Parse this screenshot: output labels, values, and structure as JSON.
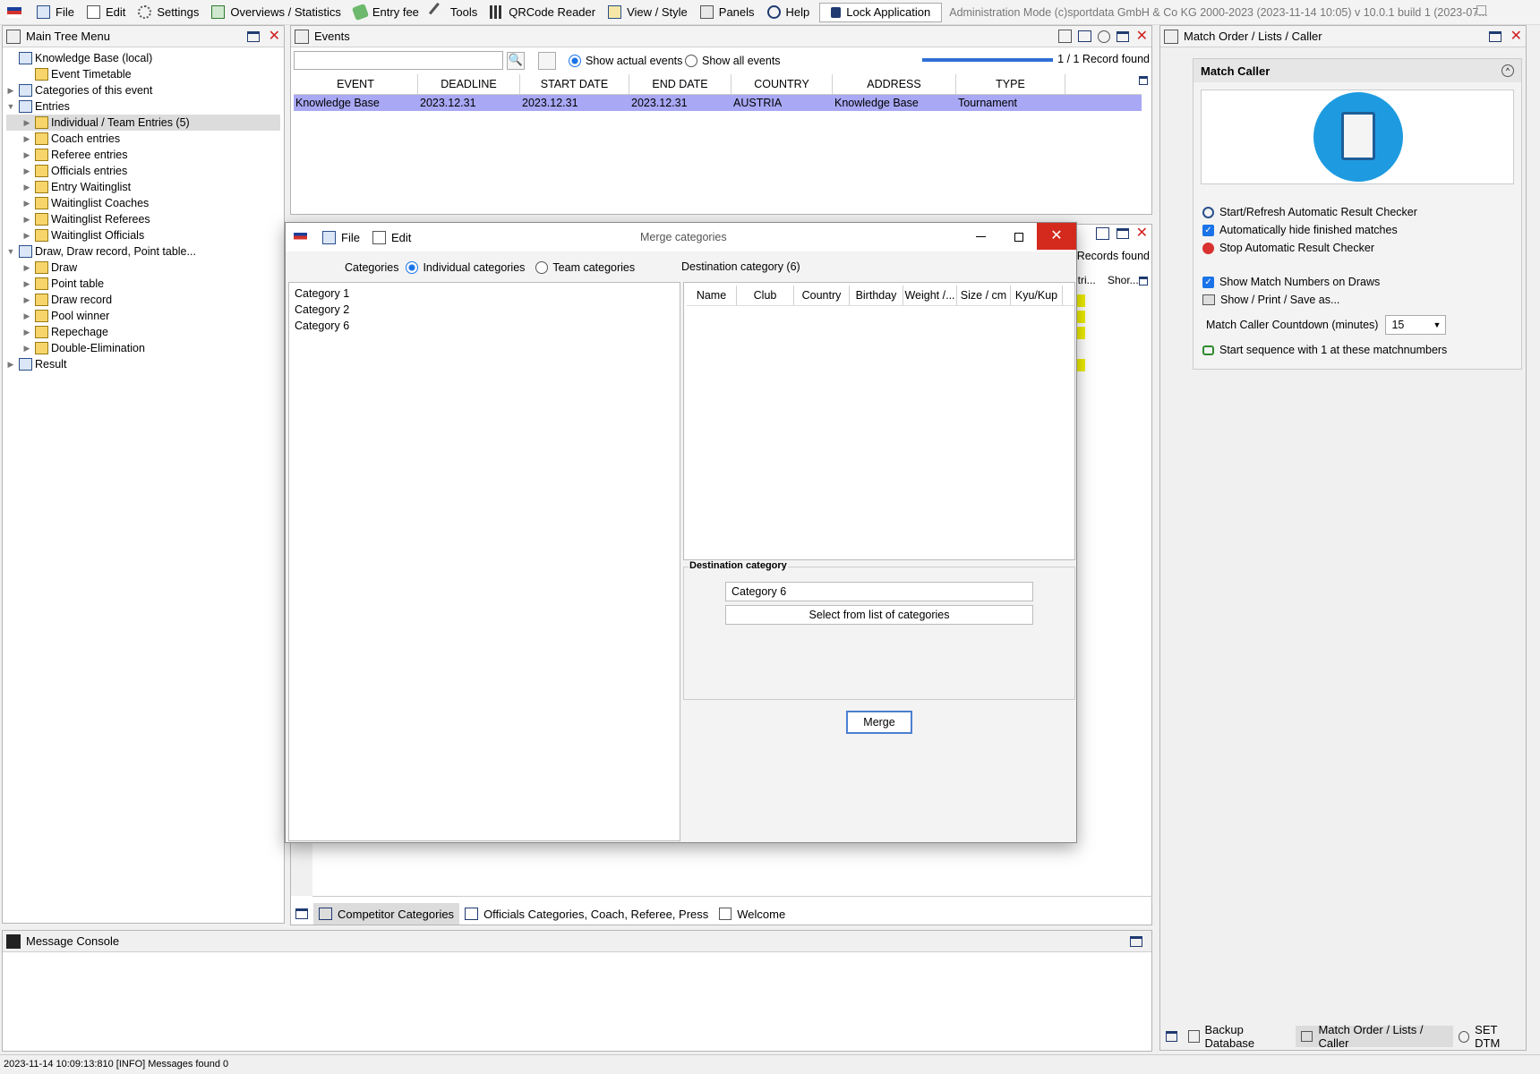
{
  "menu": {
    "items": [
      "File",
      "Edit",
      "Settings",
      "Overviews / Statistics",
      "Entry fee",
      "Tools",
      "QRCode Reader",
      "View / Style",
      "Panels",
      "Help"
    ],
    "lock": "Lock Application",
    "admin": "Administration Mode (c)sportdata GmbH & Co KG 2000-2023 (2023-11-14 10:05)  v 10.0.1 build 1 (2023-07..."
  },
  "tree": {
    "title": "Main Tree Menu",
    "items": [
      {
        "label": "Knowledge Base (local)",
        "level": 0,
        "tri": ""
      },
      {
        "label": "Event Timetable",
        "level": 1,
        "tri": ""
      },
      {
        "label": "Categories of this event",
        "level": 0,
        "tri": "▶"
      },
      {
        "label": "Entries",
        "level": 0,
        "tri": "▼"
      },
      {
        "label": "Individual / Team Entries (5)",
        "level": 1,
        "tri": "▶"
      },
      {
        "label": "Coach entries",
        "level": 1,
        "tri": "▶"
      },
      {
        "label": "Referee entries",
        "level": 1,
        "tri": "▶"
      },
      {
        "label": "Officials entries",
        "level": 1,
        "tri": "▶"
      },
      {
        "label": "Entry Waitinglist",
        "level": 1,
        "tri": "▶"
      },
      {
        "label": "Waitinglist Coaches",
        "level": 1,
        "tri": "▶"
      },
      {
        "label": "Waitinglist Referees",
        "level": 1,
        "tri": "▶"
      },
      {
        "label": "Waitinglist Officials",
        "level": 1,
        "tri": "▶"
      },
      {
        "label": "Draw, Draw record, Point table...",
        "level": 0,
        "tri": "▼"
      },
      {
        "label": "Draw",
        "level": 1,
        "tri": "▶"
      },
      {
        "label": "Point table",
        "level": 1,
        "tri": "▶"
      },
      {
        "label": "Draw record",
        "level": 1,
        "tri": "▶"
      },
      {
        "label": "Pool winner",
        "level": 1,
        "tri": "▶"
      },
      {
        "label": "Repechage",
        "level": 1,
        "tri": "▶"
      },
      {
        "label": "Double-Elimination",
        "level": 1,
        "tri": "▶"
      },
      {
        "label": "Result",
        "level": 0,
        "tri": "▶"
      }
    ]
  },
  "events": {
    "title": "Events",
    "show_actual": "Show actual events",
    "show_all": "Show all events",
    "records": "1 / 1 Record found",
    "columns": [
      "EVENT",
      "DEADLINE",
      "START DATE",
      "END DATE",
      "COUNTRY",
      "ADDRESS",
      "TYPE"
    ],
    "row": [
      "Knowledge Base",
      "2023.12.31",
      "2023.12.31",
      "2023.12.31",
      "AUSTRIA",
      "Knowledge Base",
      "Tournament"
    ]
  },
  "bgpanel": {
    "records": "5 Records found",
    "col1": "ntri...",
    "col2": "Shor..."
  },
  "dialog": {
    "title": "Merge categories",
    "file": "File",
    "edit": "Edit",
    "categories_label": "Categories",
    "individual": "Individual categories",
    "team": "Team categories",
    "destination_header": "Destination category (6)",
    "list": [
      "Category 1",
      "Category 2",
      "Category 6"
    ],
    "columns": [
      "Name",
      "Club",
      "Country",
      "Birthday",
      "Weight /...",
      "Size / cm",
      "Kyu/Kup"
    ],
    "dest_group": "Destination category",
    "dest_value": "Category 6",
    "select_btn": "Select from list of categories",
    "merge_btn": "Merge"
  },
  "bottom_tabs": [
    "Competitor Categories",
    "Officials Categories, Coach, Referee, Press",
    "Welcome"
  ],
  "console": {
    "title": "Message Console",
    "status": "2023-11-14 10:09:13:810 [INFO] Messages found 0"
  },
  "match": {
    "title": "Match Order / Lists / Caller",
    "section": "Match Caller",
    "start": "Start/Refresh Automatic Result Checker",
    "hide": "Automatically hide finished matches",
    "stop": "Stop Automatic Result Checker",
    "show_numbers": "Show Match Numbers on Draws",
    "print": "Show / Print / Save as...",
    "countdown_label": "Match Caller Countdown (minutes)",
    "countdown_value": "15",
    "sequence": "Start sequence with 1 at these matchnumbers"
  },
  "right_tabs": [
    "Backup Database",
    "Match Order / Lists / Caller",
    "SET DTM"
  ]
}
